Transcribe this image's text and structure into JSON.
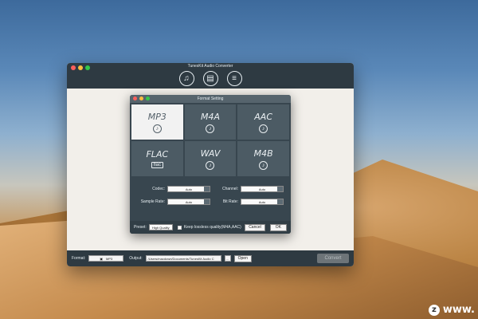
{
  "window": {
    "title": "TunesKit Audio Converter",
    "toolbar": [
      {
        "icon": "music-note-icon"
      },
      {
        "icon": "document-icon"
      },
      {
        "icon": "list-check-icon"
      }
    ]
  },
  "dialog": {
    "title": "Format Setting",
    "formats": [
      {
        "name": "MP3",
        "selected": true,
        "icon": "music-note-icon"
      },
      {
        "name": "M4A",
        "selected": false,
        "icon": "music-note-icon"
      },
      {
        "name": "AAC",
        "selected": false,
        "icon": "music-note-icon"
      },
      {
        "name": "FLAC",
        "selected": false,
        "icon": "flac-icon",
        "badge": "flac"
      },
      {
        "name": "WAV",
        "selected": false,
        "icon": "music-note-icon"
      },
      {
        "name": "M4B",
        "selected": false,
        "icon": "music-note-icon"
      }
    ],
    "codec_label": "Codec:",
    "codec_value": "Auto",
    "channel_label": "Channel:",
    "channel_value": "Auto",
    "sample_rate_label": "Sample Rate:",
    "sample_rate_value": "Auto",
    "bit_rate_label": "Bit Rate:",
    "bit_rate_value": "Auto",
    "preset_label": "Preset:",
    "preset_value": "High Quality",
    "lossless_label": "Keep lossless quality(M4A,AAC)",
    "cancel_label": "Cancel",
    "ok_label": "OK"
  },
  "footer": {
    "format_label": "Format:",
    "format_value": "MP3",
    "output_label": "Output:",
    "output_value": "/Users/macdown/Documents/TunesKit Audio C",
    "browse_label": "...",
    "open_label": "Open",
    "convert_label": "Convert"
  },
  "watermark": {
    "text": "www."
  },
  "colors": {
    "titlebar": "#2e3a42",
    "dialog_bg": "#38464f",
    "tile_bg": "#4c5b64",
    "tile_selected_bg": "#f2f2f2"
  }
}
